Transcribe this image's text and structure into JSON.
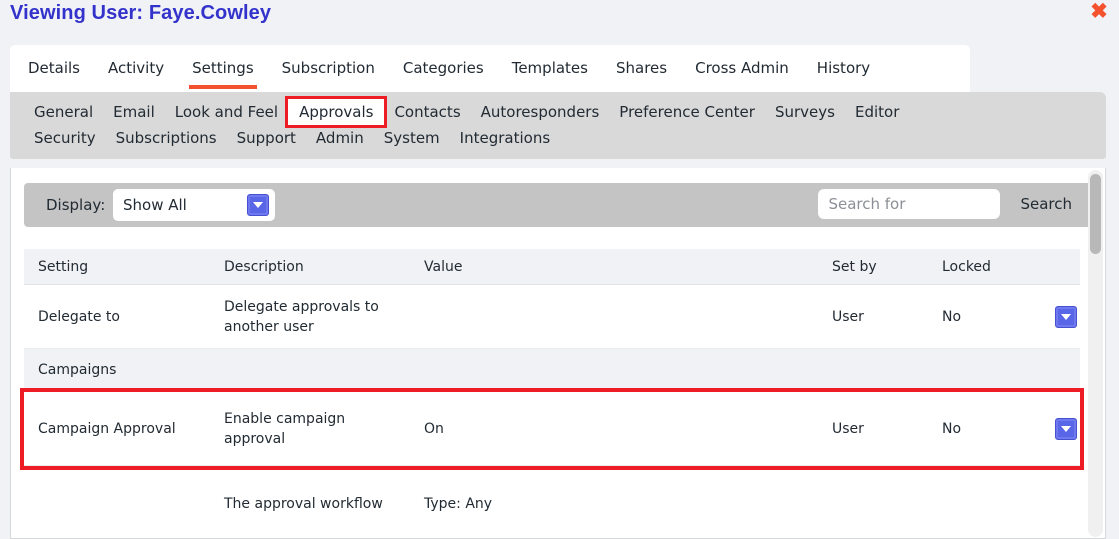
{
  "header": {
    "title": "Viewing User: Faye.Cowley",
    "close_label": "✖",
    "title_color": "#3333cc",
    "close_color": "#f4522f"
  },
  "main_tabs": {
    "active": "Settings",
    "accent_color": "#f4522f",
    "items": [
      {
        "label": "Details"
      },
      {
        "label": "Activity"
      },
      {
        "label": "Settings"
      },
      {
        "label": "Subscription"
      },
      {
        "label": "Categories"
      },
      {
        "label": "Templates"
      },
      {
        "label": "Shares"
      },
      {
        "label": "Cross Admin"
      },
      {
        "label": "History"
      }
    ]
  },
  "sub_tabs": {
    "active": "Approvals",
    "highlight_color": "#ee1c25",
    "row1": [
      {
        "label": "General"
      },
      {
        "label": "Email"
      },
      {
        "label": "Look and Feel"
      },
      {
        "label": "Approvals"
      },
      {
        "label": "Contacts"
      },
      {
        "label": "Autoresponders"
      },
      {
        "label": "Preference Center"
      },
      {
        "label": "Surveys"
      },
      {
        "label": "Editor"
      }
    ],
    "row2": [
      {
        "label": "Security"
      },
      {
        "label": "Subscriptions"
      },
      {
        "label": "Support"
      },
      {
        "label": "Admin"
      },
      {
        "label": "System"
      },
      {
        "label": "Integrations"
      }
    ]
  },
  "filter_bar": {
    "display_label": "Display:",
    "display_value": "Show All",
    "display_options": [
      "Show All"
    ],
    "search_placeholder": "Search for",
    "search_value": "",
    "search_button": "Search"
  },
  "table": {
    "columns": {
      "setting": "Setting",
      "description": "Description",
      "value": "Value",
      "set_by": "Set by",
      "locked": "Locked"
    },
    "rows": [
      {
        "kind": "setting",
        "setting": "Delegate to",
        "description": "Delegate approvals to another user",
        "value": "",
        "set_by": "User",
        "locked": "No",
        "highlighted": false
      },
      {
        "kind": "section",
        "setting": "Campaigns"
      },
      {
        "kind": "setting",
        "setting": "Campaign Approval",
        "description": "Enable campaign approval",
        "value": "On",
        "set_by": "User",
        "locked": "No",
        "highlighted": true
      },
      {
        "kind": "clipped",
        "setting": "",
        "description": "The approval workflow",
        "value": "Type: Any",
        "set_by": "",
        "locked": "",
        "highlighted": false
      }
    ]
  },
  "scrollbar": {
    "position_label": "vertical-scrollbar"
  }
}
